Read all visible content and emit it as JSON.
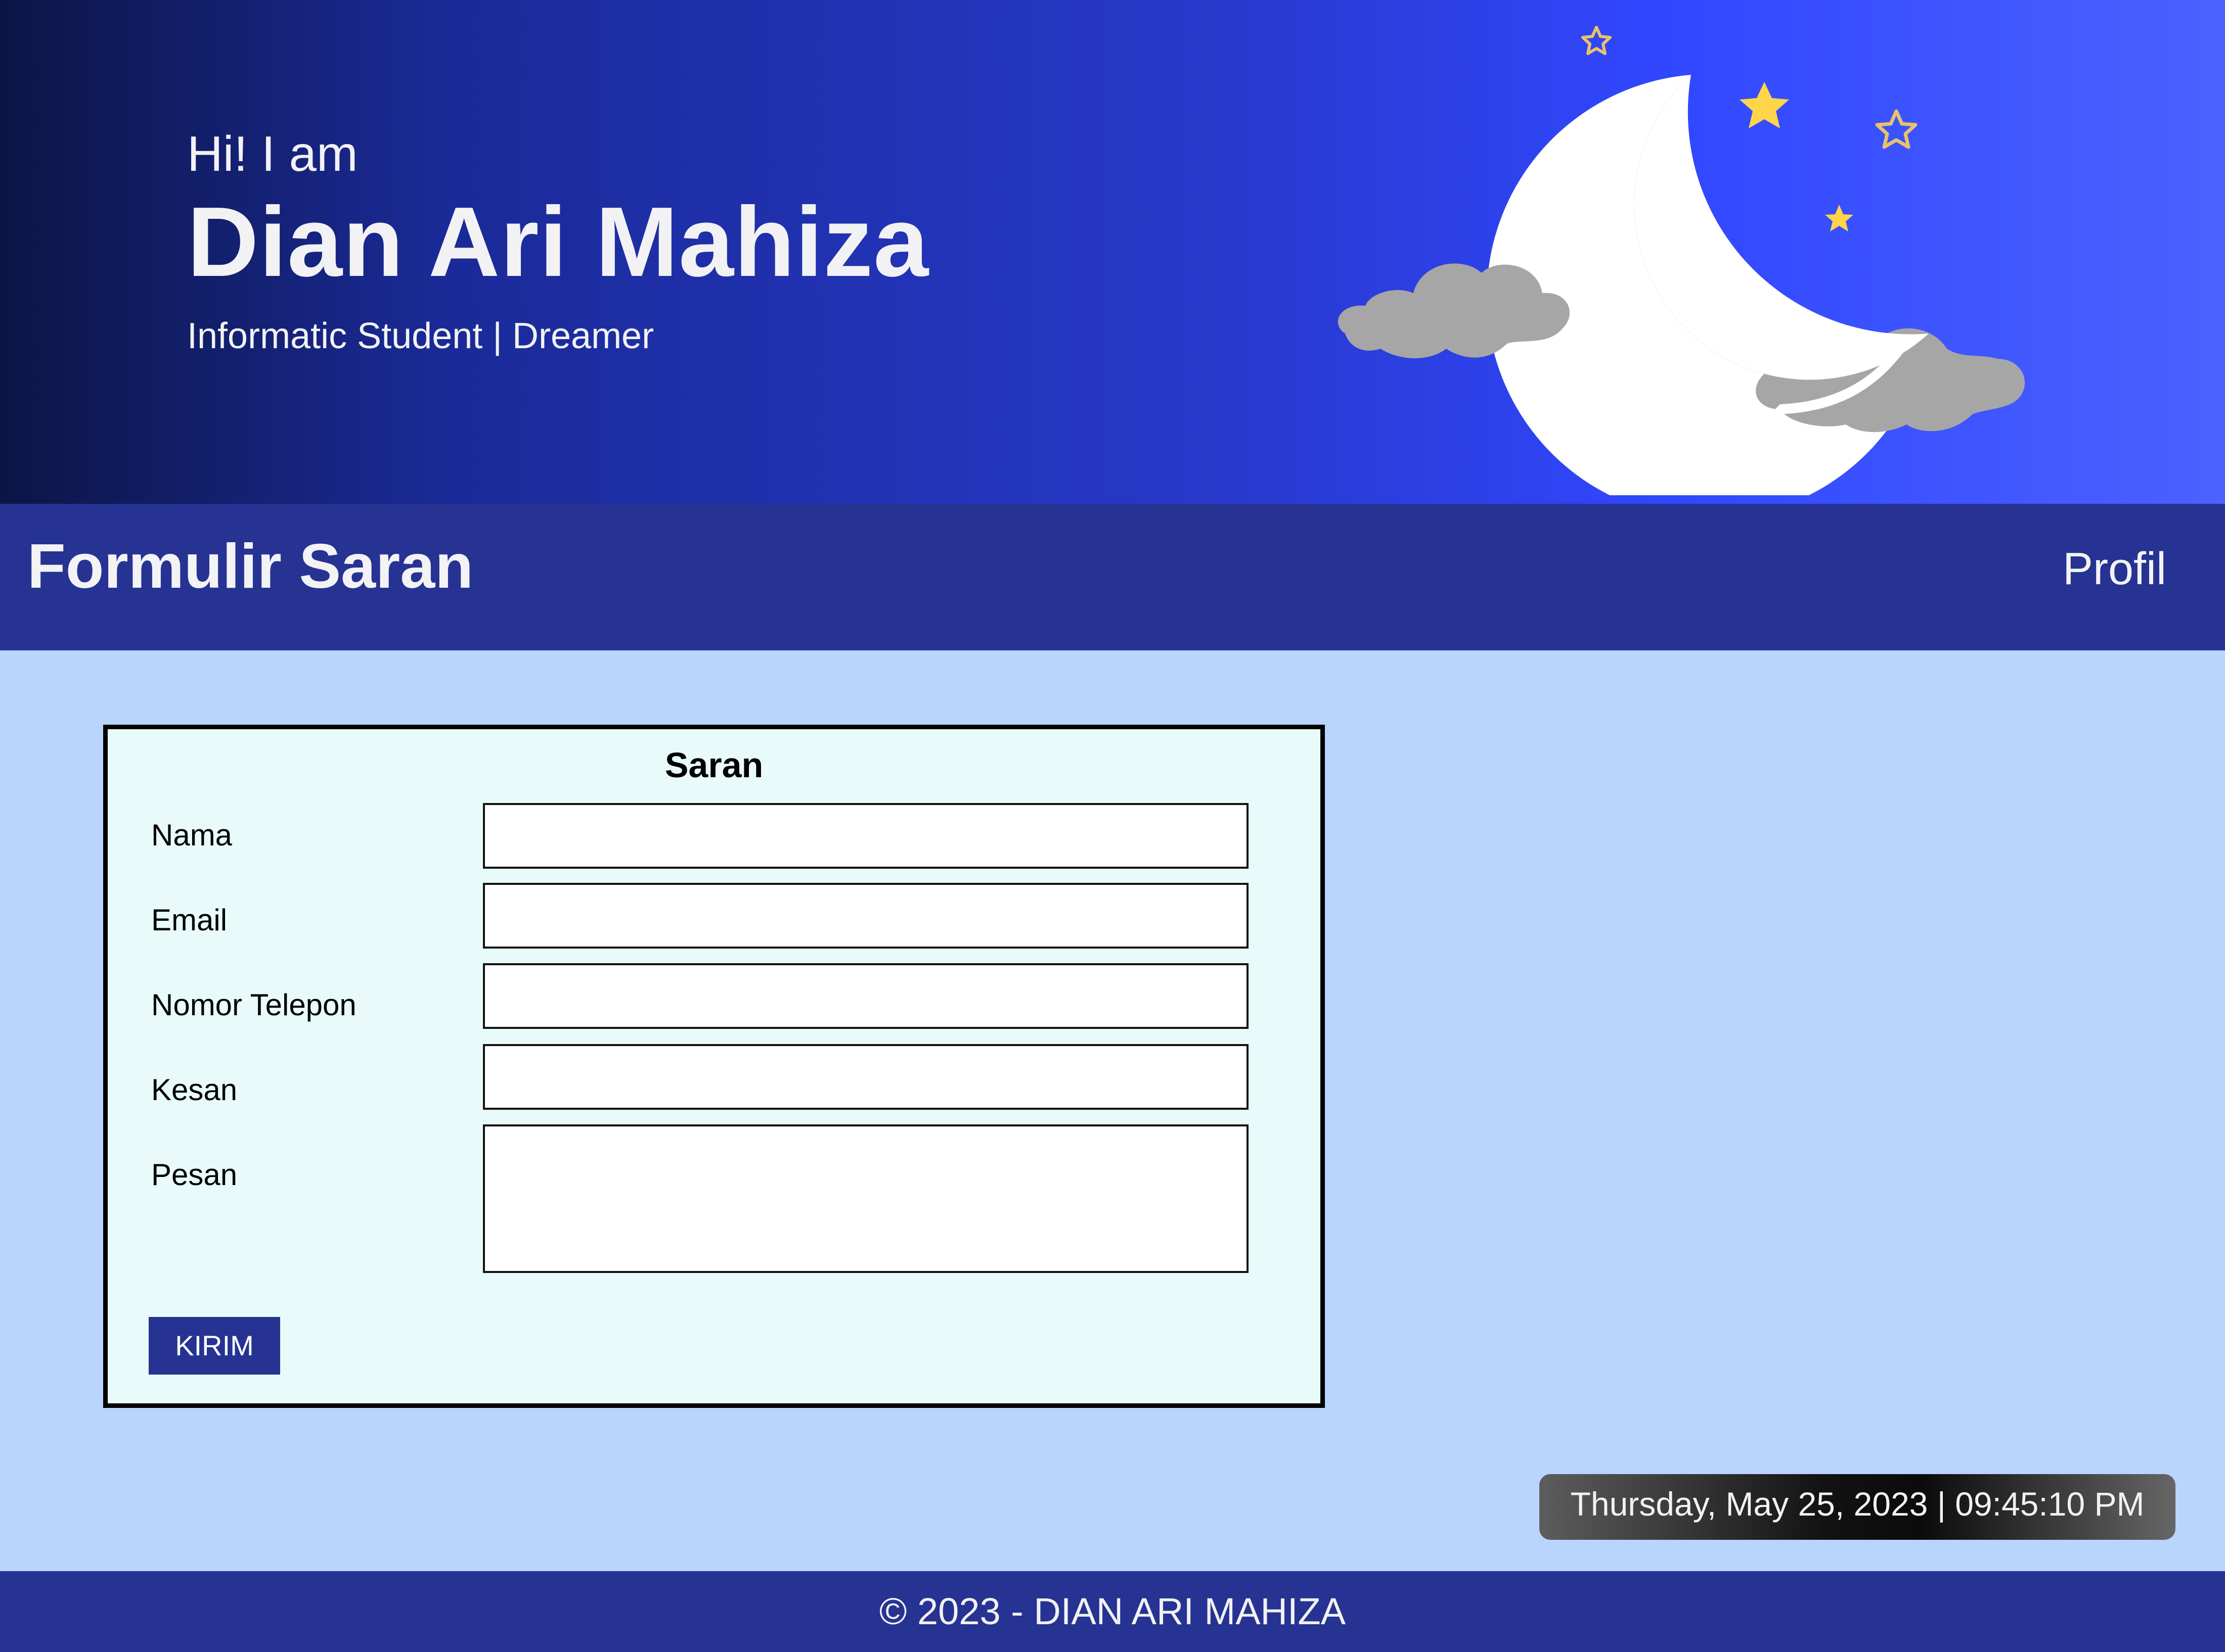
{
  "hero": {
    "greeting": "Hi! I am",
    "name": "Dian Ari Mahiza",
    "subtitle": "Informatic Student | Dreamer"
  },
  "navbar": {
    "title": "Formulir Saran",
    "link_profile": "Profil"
  },
  "form": {
    "heading": "Saran",
    "fields": [
      {
        "label": "Nama",
        "value": ""
      },
      {
        "label": "Email",
        "value": ""
      },
      {
        "label": "Nomor Telepon",
        "value": ""
      },
      {
        "label": "Kesan",
        "value": ""
      },
      {
        "label": "Pesan",
        "value": ""
      }
    ],
    "submit_label": "KIRIM"
  },
  "clock": {
    "text": "Thursday, May 25, 2023 | 09:45:10 PM"
  },
  "footer": {
    "text": "© 2023 - DIAN ARI MAHIZA"
  },
  "colors": {
    "navbar": "#263392",
    "page_bg": "#b9d4fd",
    "form_bg": "#e8fbfa",
    "moon": "#ffffff",
    "cloud": "#a6a6a6",
    "star": "#ffd54a"
  },
  "icons": [
    "moon-icon",
    "cloud-icon",
    "star-icon"
  ]
}
